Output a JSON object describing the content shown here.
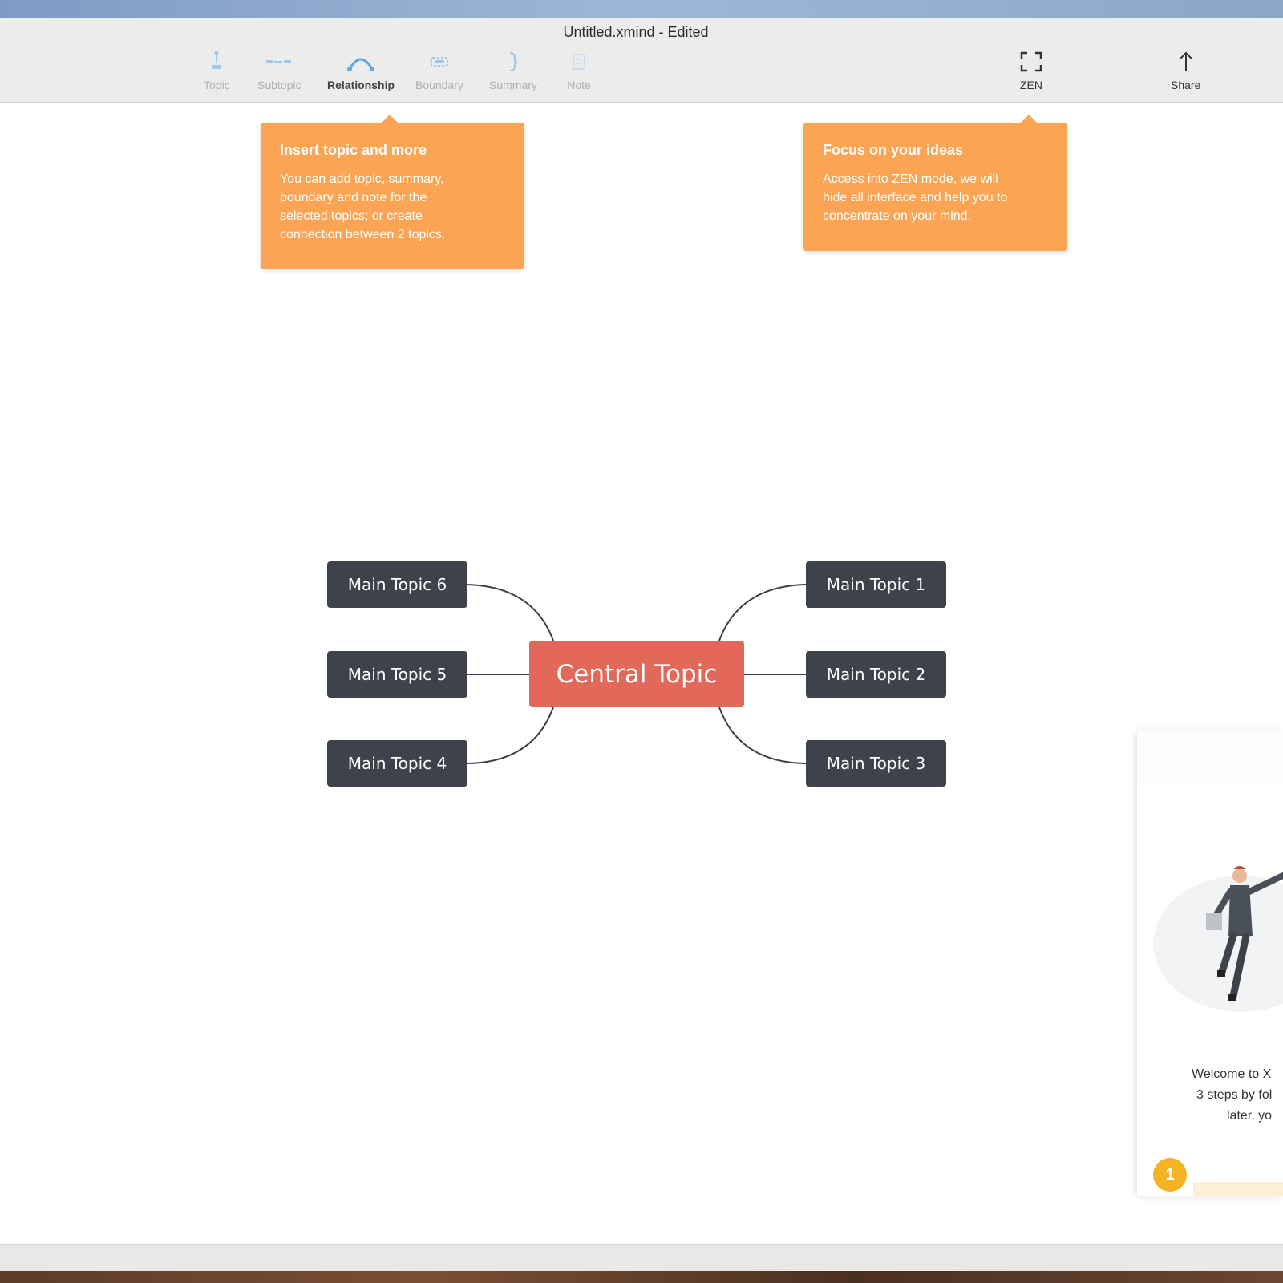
{
  "window": {
    "title": "Untitled.xmind - Edited"
  },
  "toolbar": {
    "items": [
      {
        "label": "Topic",
        "icon": "topic-icon",
        "state": "disabled"
      },
      {
        "label": "Subtopic",
        "icon": "subtopic-icon",
        "state": "disabled"
      },
      {
        "label": "Relationship",
        "icon": "relationship-icon",
        "state": "active"
      },
      {
        "label": "Boundary",
        "icon": "boundary-icon",
        "state": "disabled"
      },
      {
        "label": "Summary",
        "icon": "summary-icon",
        "state": "disabled"
      },
      {
        "label": "Note",
        "icon": "note-icon",
        "state": "disabled"
      }
    ],
    "zen": {
      "label": "ZEN",
      "icon": "fullscreen-icon"
    },
    "share": {
      "label": "Share",
      "icon": "share-icon"
    }
  },
  "tooltips": {
    "insert": {
      "title": "Insert topic and more",
      "lines": [
        "You can add topic, summary,",
        "boundary and note for the",
        "selected topics; or create",
        "connection between 2 topics."
      ]
    },
    "focus": {
      "title": "Focus on your ideas",
      "lines": [
        "Access into ZEN mode, we will",
        "hide all interface and help you to",
        "concentrate on your mind."
      ]
    }
  },
  "mindmap": {
    "central": "Central Topic",
    "topics": {
      "t1": "Main Topic 1",
      "t2": "Main Topic 2",
      "t3": "Main Topic 3",
      "t4": "Main Topic 4",
      "t5": "Main Topic 5",
      "t6": "Main Topic 6"
    }
  },
  "welcome": {
    "lines": [
      "Welcome to X",
      "3 steps by fol",
      "later, yo"
    ],
    "step": "1"
  },
  "colors": {
    "central": "#e2685a",
    "main_topic": "#3d424b",
    "tooltip": "#fba454",
    "toolbar_icon": "#5aa8e0",
    "step_badge": "#f4b323"
  }
}
